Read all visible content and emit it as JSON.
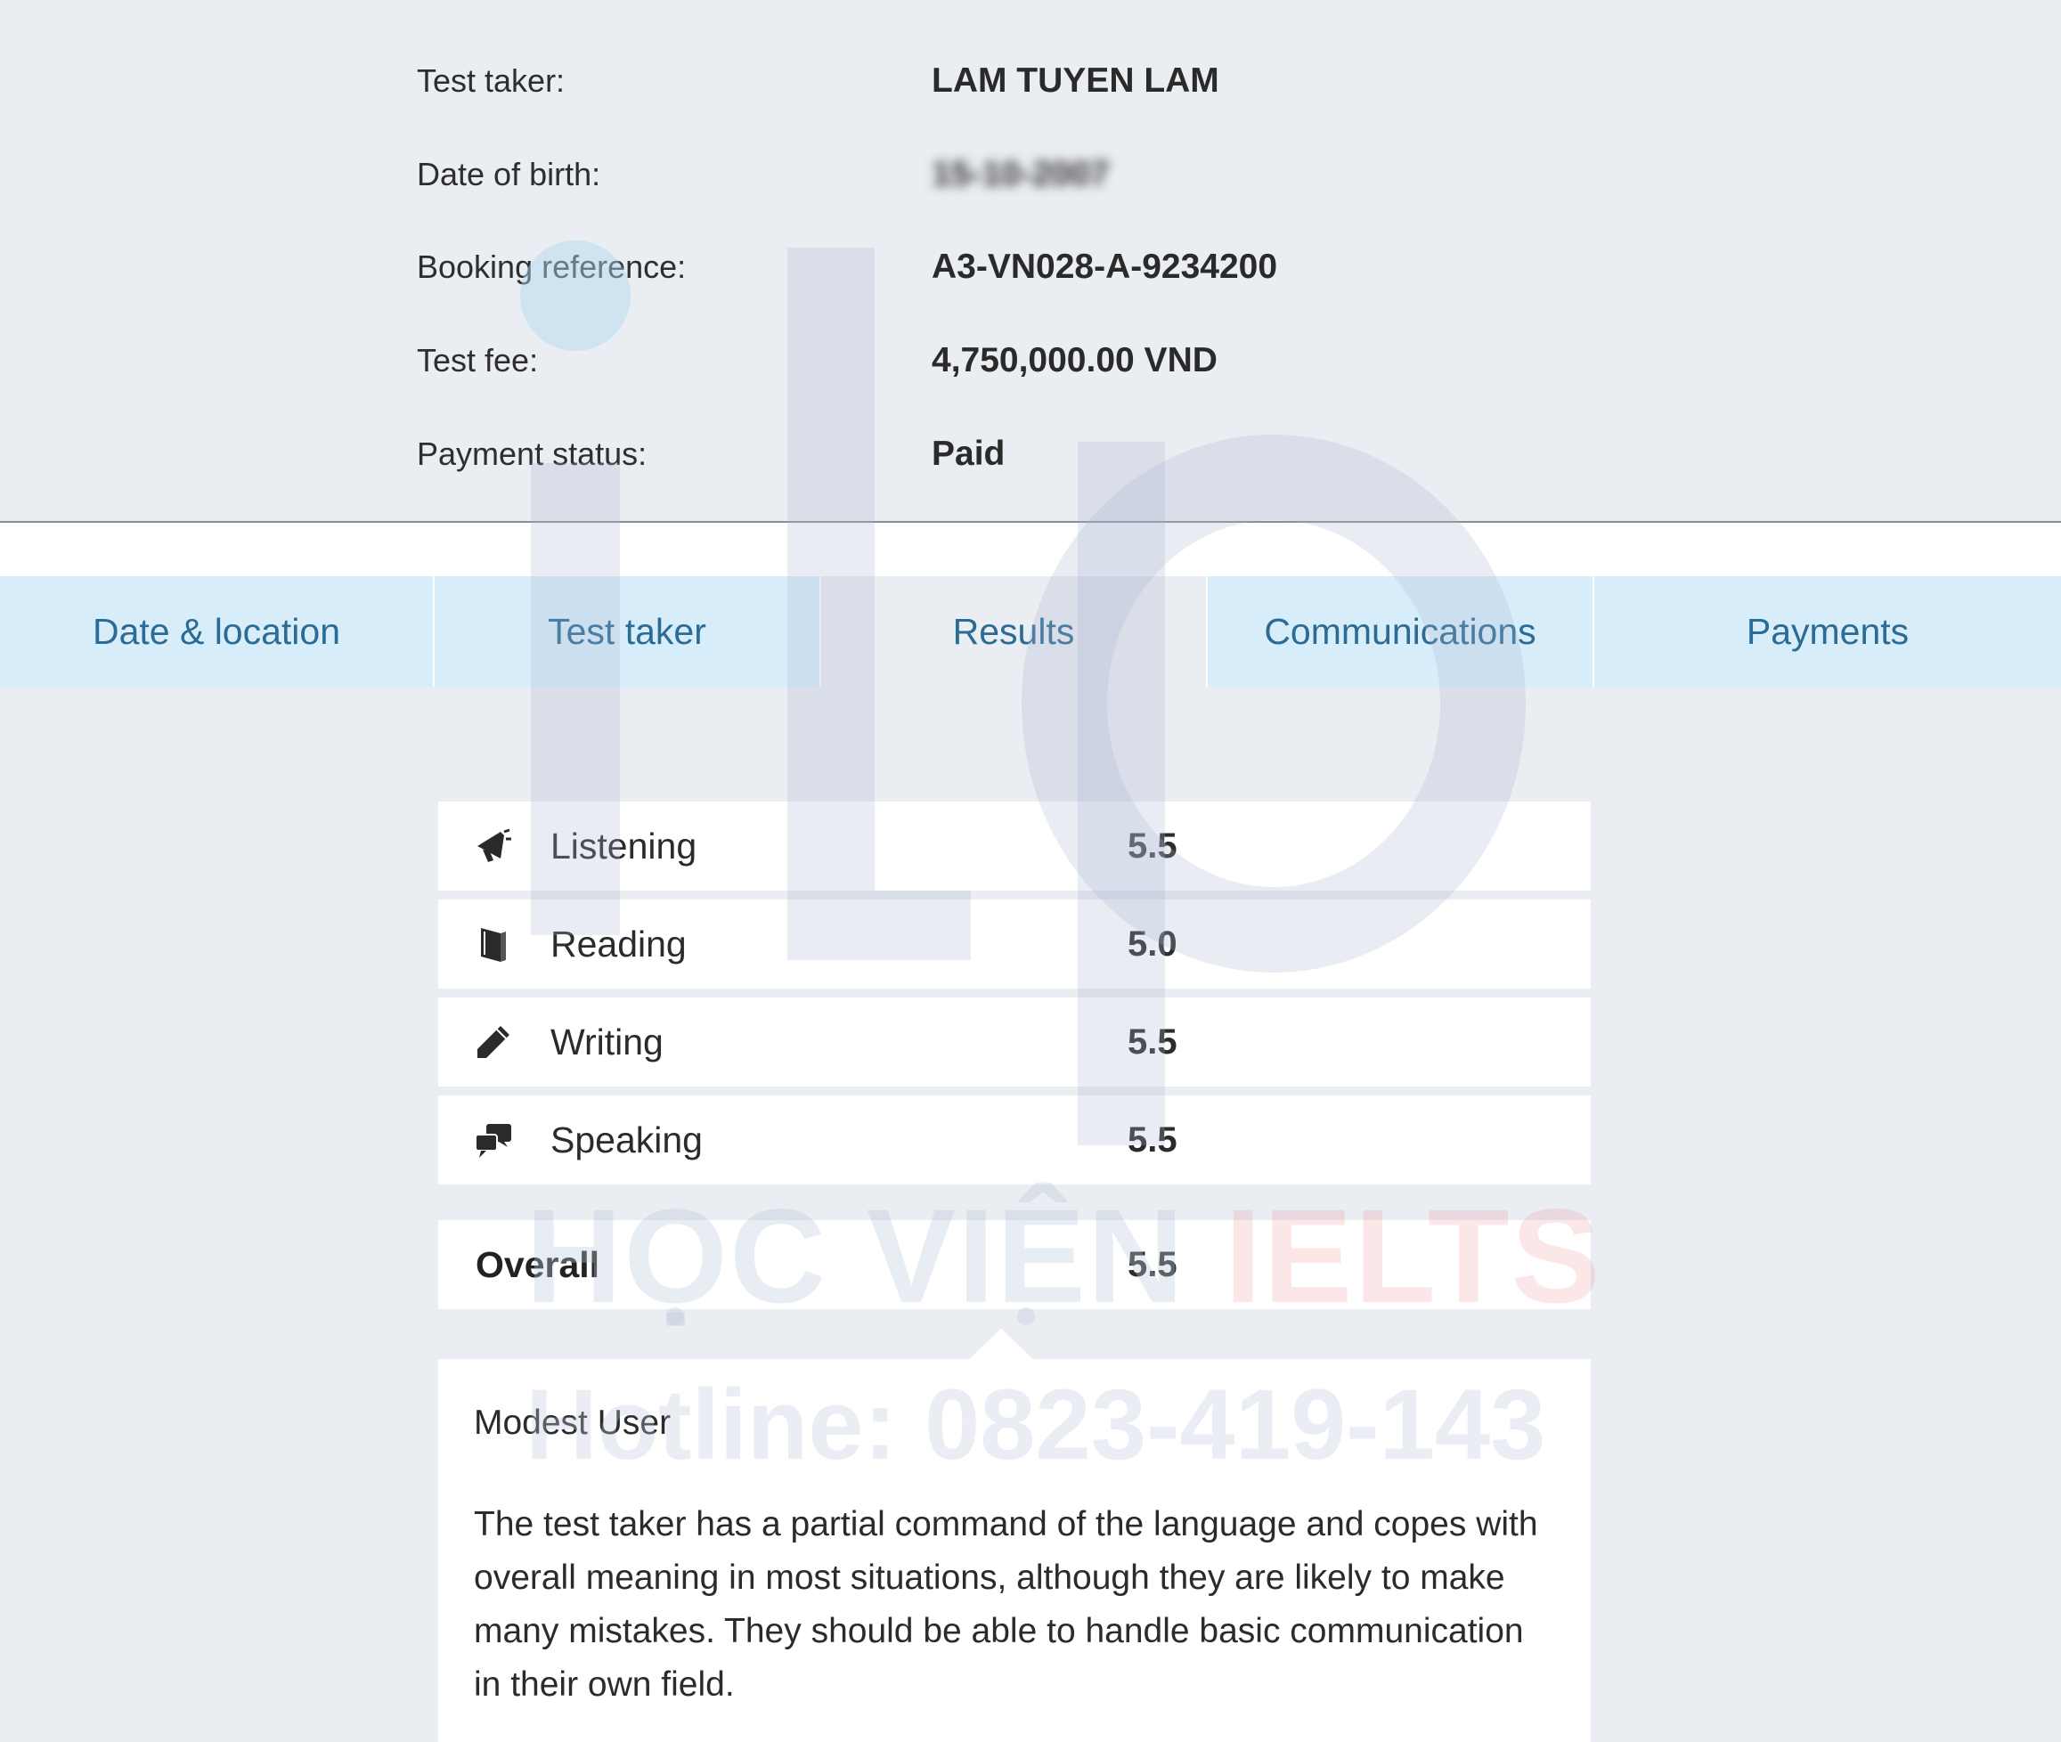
{
  "booking": {
    "test_taker_label": "Test taker:",
    "test_taker_value": "LAM TUYEN LAM",
    "dob_label": "Date of birth:",
    "dob_value": "15-10-2007",
    "booking_ref_label": "Booking reference:",
    "booking_ref_value": "A3-VN028-A-9234200",
    "fee_label": "Test fee:",
    "fee_value": "4,750,000.00 VND",
    "payment_label": "Payment status:",
    "payment_value": "Paid"
  },
  "tabs": [
    {
      "label": "Date & location"
    },
    {
      "label": "Test taker"
    },
    {
      "label": "Results"
    },
    {
      "label": "Communications"
    },
    {
      "label": "Payments"
    }
  ],
  "active_tab": "Results",
  "results": {
    "listening": {
      "label": "Listening",
      "score": "5.5",
      "icon": "megaphone-icon"
    },
    "reading": {
      "label": "Reading",
      "score": "5.0",
      "icon": "book-icon"
    },
    "writing": {
      "label": "Writing",
      "score": "5.5",
      "icon": "pencil-icon"
    },
    "speaking": {
      "label": "Speaking",
      "score": "5.5",
      "icon": "speech-bubbles-icon"
    },
    "overall": {
      "label": "Overall",
      "score": "5.5"
    }
  },
  "band_description": {
    "title": "Modest User",
    "text": "The test taker has a partial command of the language and copes with overall meaning in most situations, although they are likely to make many mistakes. They should be able to handle basic communication in their own field."
  },
  "watermark": {
    "brand_part1": "HỌC VIÊN ",
    "brand_part2": "IELTS",
    "hotline": "Hotline: 0823-419-143"
  },
  "colors": {
    "page_bg": "#eaedf2",
    "tab_bg": "#d7eefa",
    "tab_text": "#2c6b94",
    "panel_bg": "#ffffff"
  }
}
